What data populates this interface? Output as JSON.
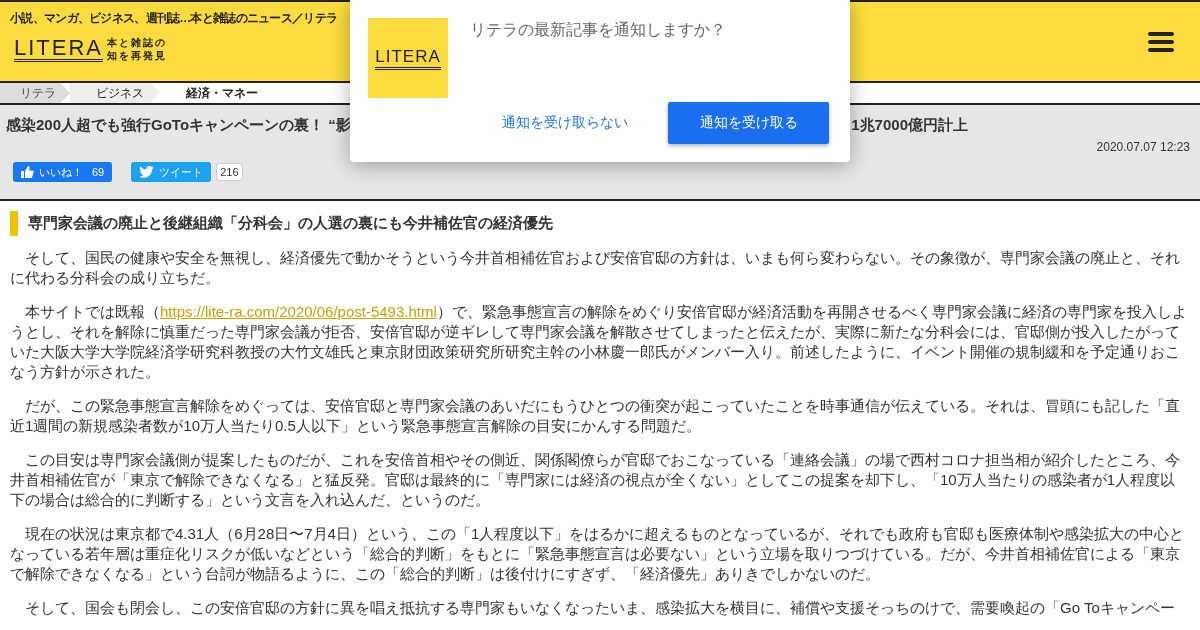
{
  "header": {
    "tagline": "小説、マンガ、ビジネス、週刊誌…本と雑誌のニュース／リテラ",
    "logo": {
      "wordmark": "LITERA",
      "slogan_line_1": "本と雑誌の",
      "slogan_line_2": "知を再発見"
    }
  },
  "breadcrumbs": [
    {
      "label": "リテラ",
      "selected": false
    },
    {
      "label": "ビジネス",
      "selected": false
    },
    {
      "label": "経済・マネー",
      "selected": true
    }
  ],
  "article": {
    "title_start": "感染200人超でも強行GoToキャンペーンの裏！ “影",
    "title_end": "1兆7000億円計上",
    "date": "2020.07.07 12:23",
    "like_button": {
      "label": "いいね！",
      "count": "69"
    },
    "tweet_button": {
      "label": "ツイート",
      "count": "216"
    },
    "section_heading": "専門家会議の廃止と後継組織「分科会」の人選の裏にも今井補佐官の経済優先",
    "paragraphs": [
      {
        "text": "そして、国民の健康や安全を無視し、経済優先で動かそうという今井首相補佐官および安倍官邸の方針は、いまも何ら変わらない。その象徴が、専門家会議の廃止と、それに代わる分科会の成り立ちだ。"
      },
      {
        "before": "本サイトでは既報（",
        "link": "https://lite-ra.com/2020/06/post-5493.html",
        "text": "）で、緊急事態宣言の解除をめぐり安倍官邸が経済活動を再開させるべく専門家会議に経済の専門家を投入しようとし、それを解除に慎重だった専門家会議が拒否、安倍官邸が逆ギレして専門家会議を解散させてしまったと伝えたが、実際に新たな分科会には、官邸側が投入したがっていた大阪大学大学院経済学研究科教授の大竹文雄氏と東京財団政策研究所研究主幹の小林慶一郎氏がメンバー入り。前述したように、イベント開催の規制緩和を予定通りおこなう方針が示された。"
      },
      {
        "text": "だが、この緊急事態宣言解除をめぐっては、安倍官邸と専門家会議のあいだにもうひとつの衝突が起こっていたことを時事通信が伝えている。それは、冒頭にも記した「直近1週間の新規感染者数が10万人当たり0.5人以下」という緊急事態宣言解除の目安にかんする問題だ。"
      },
      {
        "text": "この目安は専門家会議側が提案したものだが、これを安倍首相やその側近、関係閣僚らが官邸でおこなっている「連絡会議」の場で西村コロナ担当相が紹介したところ、今井首相補佐官が「東京で解除できなくなる」と猛反発。官邸は最終的に「専門家には経済の視点が全くない」としてこの提案を却下し、「10万人当たりの感染者が1人程度以下の場合は総合的に判断する」という文言を入れ込んだ、というのだ。"
      },
      {
        "text": "現在の状況は東京都で4.31人（6月28日〜7月4日）という、この「1人程度以下」をはるかに超えるものとなっているが、それでも政府も官邸も医療体制や感染拡大の中心となっている若年層は重症化リスクが低いなどという「総合的判断」をもとに「緊急事態宣言は必要ない」という立場を取りつづけている。だが、今井首相補佐官による「東京で解除できなくなる」という台詞が物語るように、この「総合的判断」は後付けにすぎず、「経済優先」ありきでしかないのだ。"
      },
      {
        "text": "そして、国会も閉会し、この安倍官邸の方針に異を唱え抵抗する専門家もいなくなったいま、感染拡大を横目に、補償や支援そっちのけで、需要喚起の「Go Toキャンペー"
      }
    ]
  },
  "notification_prompt": {
    "logo_wordmark": "LITERA",
    "message": "リテラの最新記事を通知しますか？",
    "decline_button": "通知を受け取らない",
    "accept_button": "通知を受け取る"
  }
}
